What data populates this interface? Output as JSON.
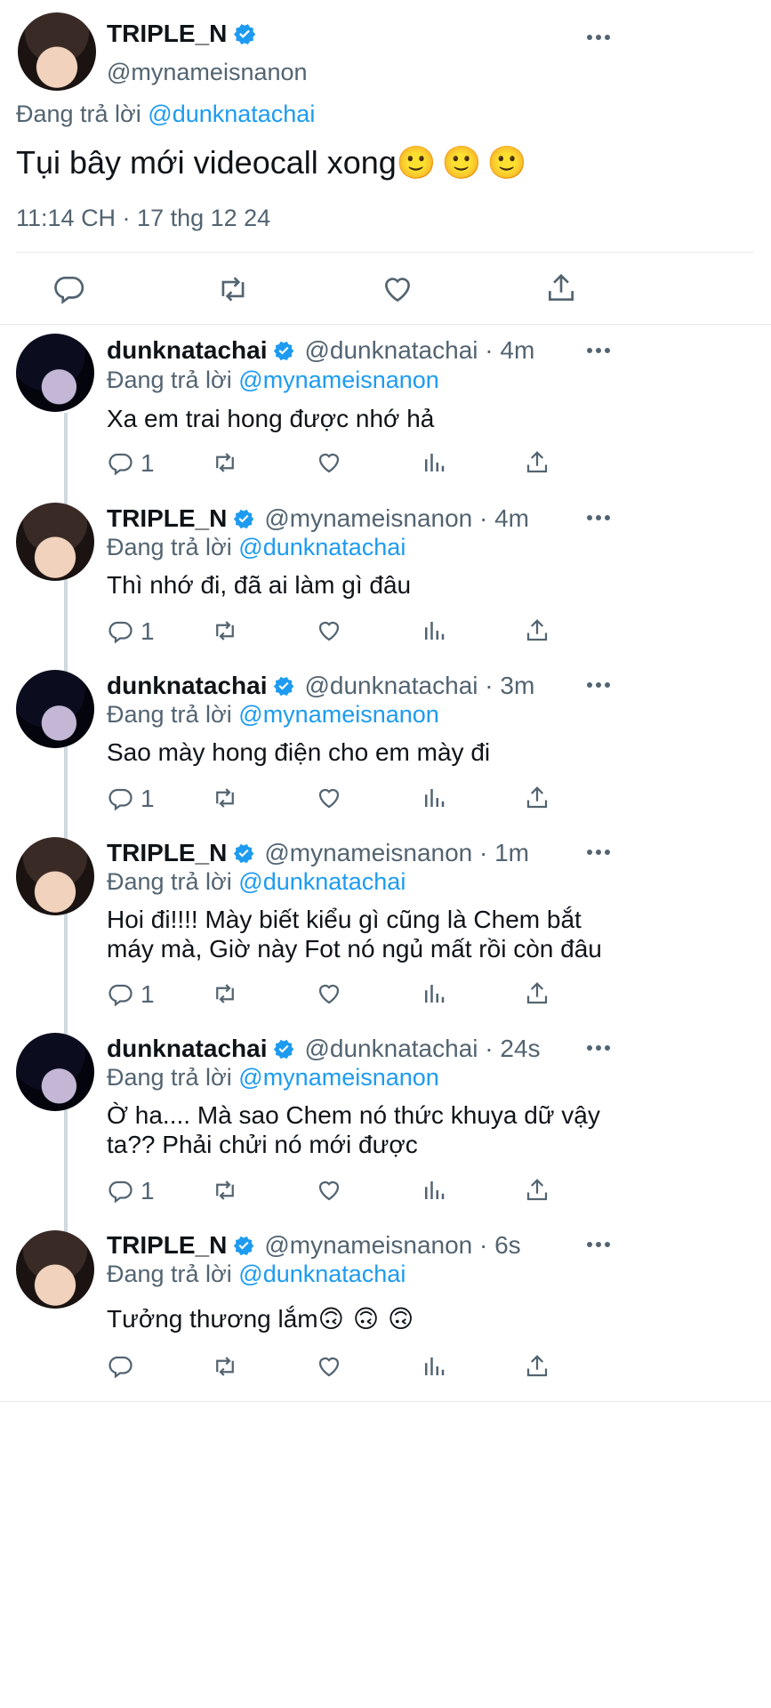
{
  "main_tweet": {
    "display_name": "TRIPLE_N",
    "handle": "@mynameisnanon",
    "reply_prefix": "Đang trả lời",
    "reply_to": "@dunknatachai",
    "text": "Tụi bây mới videocall xong",
    "emojis": [
      "🙂",
      "🙂",
      "🙂"
    ],
    "timestamp": "11:14 CH · 17 thg 12 24"
  },
  "replies": [
    {
      "display_name": "dunknatachai",
      "meta": "@dunknatachai · 4m",
      "reply_prefix": "Đang trả lời",
      "reply_to": "@mynameisnanon",
      "lines": [
        "Xa em trai hong được nhớ hả"
      ],
      "reply_count": "1"
    },
    {
      "display_name": "TRIPLE_N",
      "meta": "@mynameisnanon · 4m",
      "reply_prefix": "Đang trả lời",
      "reply_to": "@dunknatachai",
      "lines": [
        "Thì nhớ đi, đã ai làm gì đâu"
      ],
      "reply_count": "1"
    },
    {
      "display_name": "dunknatachai",
      "meta": "@dunknatachai · 3m",
      "reply_prefix": "Đang trả lời",
      "reply_to": "@mynameisnanon",
      "lines": [
        "Sao mày hong điện cho em mày đi"
      ],
      "reply_count": "1"
    },
    {
      "display_name": "TRIPLE_N",
      "meta": "@mynameisnanon · 1m",
      "reply_prefix": "Đang trả lời",
      "reply_to": "@dunknatachai",
      "lines": [
        "Hoi đi!!!! Mày biết kiểu gì cũng là Chem bắt",
        "máy mà, Giờ này Fot nó ngủ mất rồi còn đâu"
      ],
      "reply_count": "1"
    },
    {
      "display_name": "dunknatachai",
      "meta": "@dunknatachai · 24s",
      "reply_prefix": "Đang trả lời",
      "reply_to": "@mynameisnanon",
      "lines": [
        "Ờ ha.... Mà sao Chem nó thức khuya dữ vậy",
        "ta?? Phải chửi nó mới được"
      ],
      "reply_count": "1"
    },
    {
      "display_name": "TRIPLE_N",
      "meta": "@mynameisnanon · 6s",
      "reply_prefix": "Đang trả lời",
      "reply_to": "@dunknatachai",
      "lines": [
        "Tưởng thương lắm"
      ],
      "emojis": [
        "🙃",
        "🙃",
        "🙃"
      ],
      "reply_count": ""
    }
  ],
  "colors": {
    "accent": "#1d9bf0",
    "text": "#0f1419",
    "muted": "#536471",
    "divider": "#e7e9ea"
  }
}
